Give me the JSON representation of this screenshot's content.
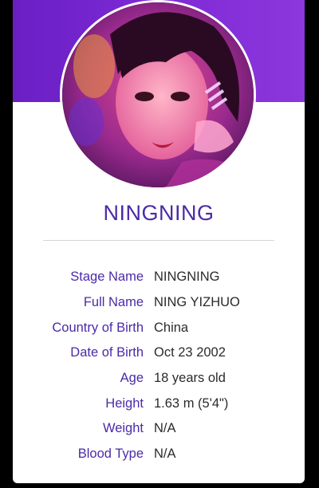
{
  "profile": {
    "name": "NINGNING",
    "photo_icon": "profile-photo"
  },
  "details": [
    {
      "label": "Stage Name",
      "value": "NINGNING"
    },
    {
      "label": "Full Name",
      "value": "NING YIZHUO"
    },
    {
      "label": "Country of Birth",
      "value": "China"
    },
    {
      "label": "Date of Birth",
      "value": "Oct 23 2002"
    },
    {
      "label": "Age",
      "value": "18 years old"
    },
    {
      "label": "Height",
      "value": "1.63 m (5'4\")"
    },
    {
      "label": "Weight",
      "value": "N/A"
    },
    {
      "label": "Blood Type",
      "value": "N/A"
    }
  ],
  "colors": {
    "accent": "#4b2aa8",
    "banner": "#7e2ad6"
  }
}
